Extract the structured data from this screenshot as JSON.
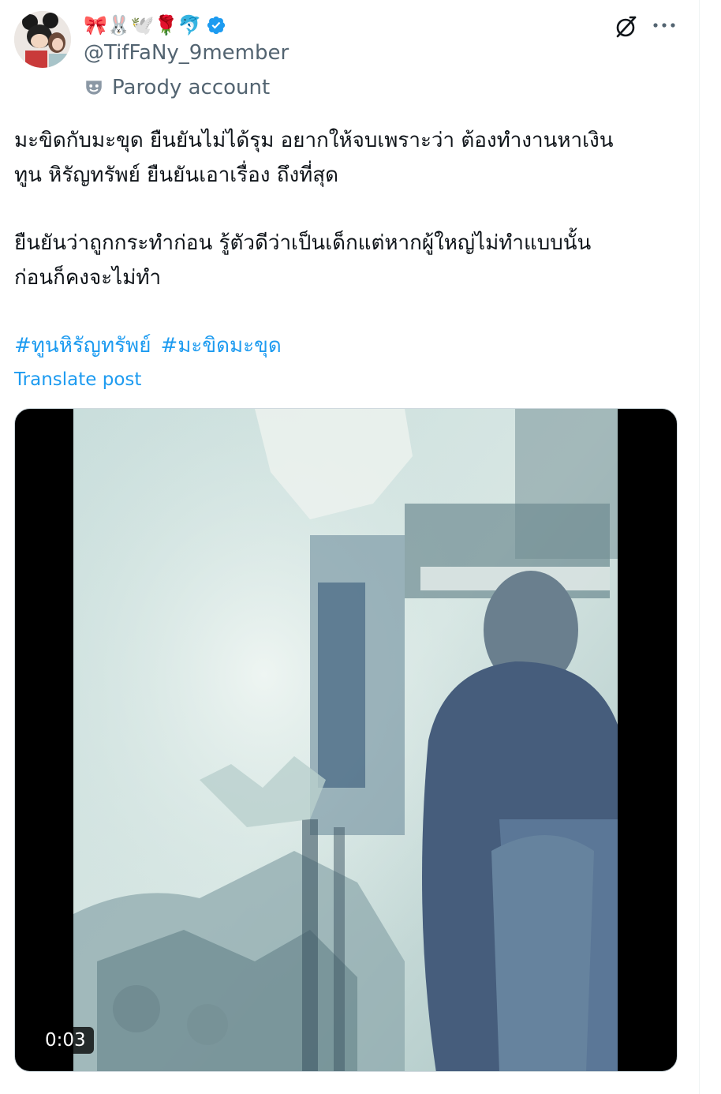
{
  "author": {
    "emoji_name": "🎀🐰🕊️🌹🐬",
    "handle": "@TifFaNy_9member",
    "parody_label": "Parody account",
    "verified": true
  },
  "icons": {
    "avatar": "avatar",
    "verified": "verified-badge-icon",
    "parody": "parody-mask-icon",
    "grok": "grok-icon",
    "more": "more-icon"
  },
  "post": {
    "paragraph1": [
      "มะขิดกับมะขุด  ยืนยันไม่ได้รุม อยากให้จบเพราะว่า ต้องทำงานหาเงิน",
      "ทูน หิรัญทรัพย์ ยืนยันเอาเรื่อง ถึงที่สุด"
    ],
    "paragraph2": [
      "ยืนยันว่าถูกกระทำก่อน รู้ตัวดีว่าเป็นเด็กแต่หากผู้ใหญ่ไม่ทำแบบนั้น",
      "ก่อนก็คงจะไม่ทำ"
    ],
    "hashtags": [
      "#ทูนหิรัญทรัพย์",
      "#มะขิดมะขุด"
    ],
    "translate_label": "Translate post"
  },
  "video": {
    "duration": "0:03"
  },
  "colors": {
    "link": "#1d9bf0",
    "text": "#0f1419",
    "secondary": "#536471",
    "verified": "#1d9bf0"
  }
}
